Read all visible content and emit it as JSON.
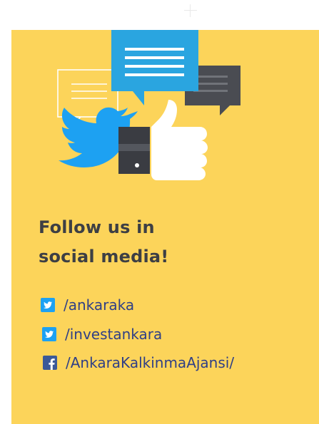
{
  "card": {
    "heading_line1": "Follow us in",
    "heading_line2": "social media!",
    "background": "#fcd45a"
  },
  "colors": {
    "heading": "#3d3f44",
    "link": "#2f3f86",
    "twitter": "#1da1f2",
    "bubble_blue": "#2aa5e0",
    "bubble_dark": "#4a4c52",
    "facebook": "#3b5998"
  },
  "social_links": [
    {
      "icon": "twitter-icon",
      "label": "/ankaraka"
    },
    {
      "icon": "twitter-icon",
      "label": "/investankara"
    },
    {
      "icon": "facebook-icon",
      "label": "/AnkaraKalkinmaAjansi/"
    }
  ]
}
